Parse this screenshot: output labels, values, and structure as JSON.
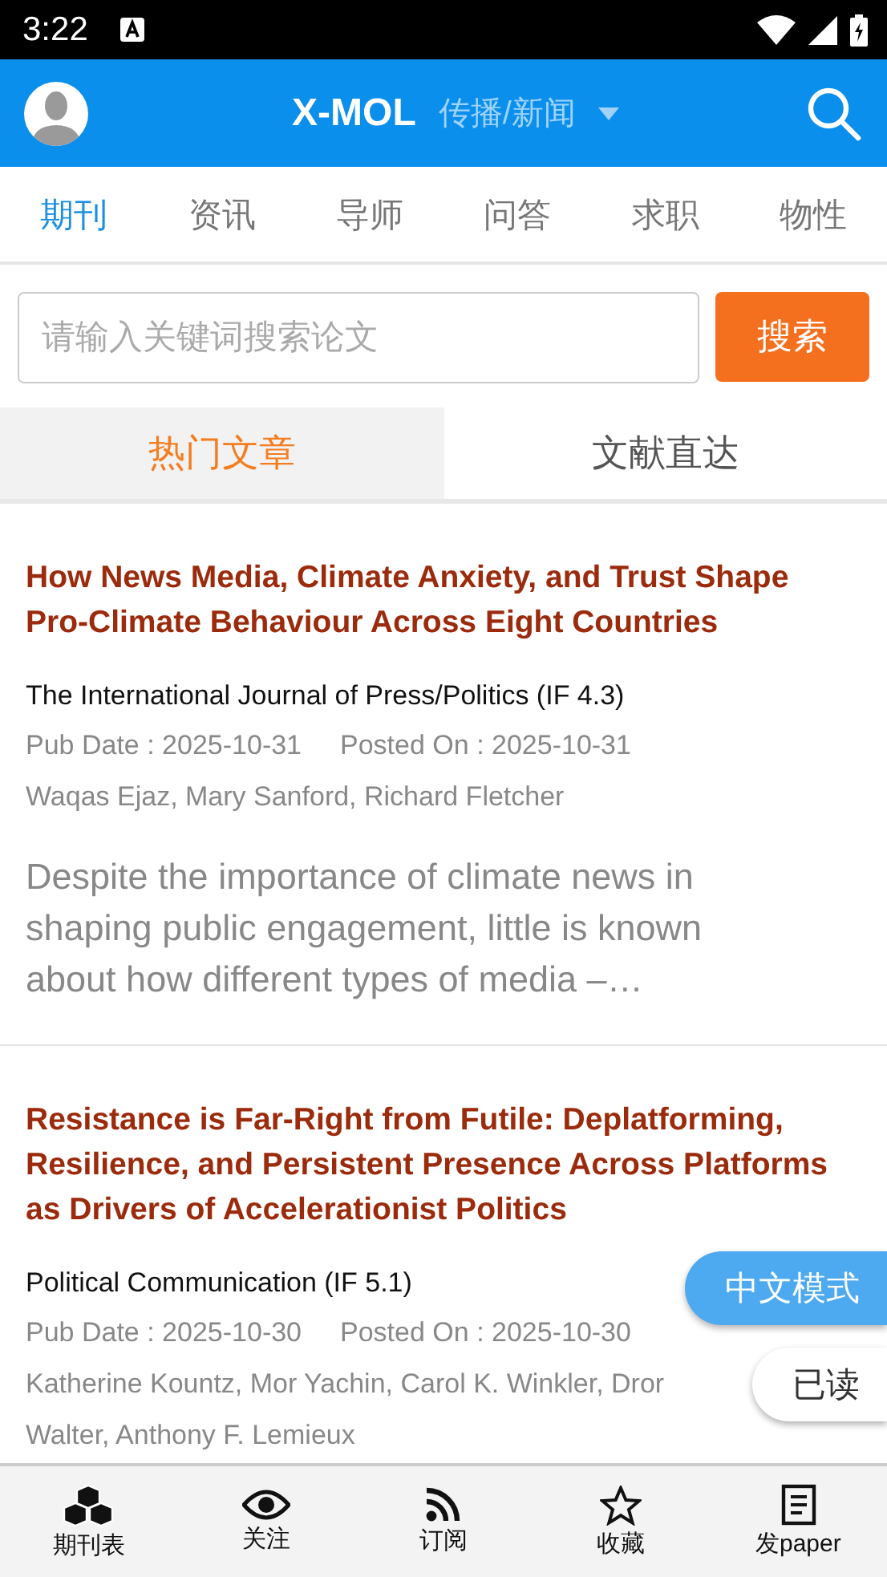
{
  "status_bar": {
    "time": "3:22"
  },
  "header": {
    "logo": "X-MOL",
    "channel": "传播/新闻"
  },
  "tabs": [
    {
      "label": "期刊",
      "selected": true
    },
    {
      "label": "资讯",
      "selected": false
    },
    {
      "label": "导师",
      "selected": false
    },
    {
      "label": "问答",
      "selected": false
    },
    {
      "label": "求职",
      "selected": false
    },
    {
      "label": "物性",
      "selected": false
    }
  ],
  "search": {
    "placeholder": "请输入关键词搜索论文",
    "button": "搜索"
  },
  "segments": [
    {
      "label": "热门文章",
      "selected": true
    },
    {
      "label": "文献直达",
      "selected": false
    }
  ],
  "articles": [
    {
      "title": "How News Media, Climate Anxiety, and Trust Shape Pro-Climate Behaviour Across Eight Countries",
      "journal": "The International Journal of Press/Politics (IF 4.3)",
      "pub_date": "Pub Date : 2025-10-31",
      "posted_on": "Posted On : 2025-10-31",
      "authors": "Waqas Ejaz, Mary Sanford, Richard Fletcher",
      "abstract": "Despite the importance of climate news in shaping public engagement, little is known about how different types of media –…"
    },
    {
      "title": "Resistance is Far-Right from Futile: Deplatforming, Resilience, and Persistent Presence Across Platforms as Drivers of Accelerationist Politics",
      "journal": "Political Communication (IF 5.1)",
      "pub_date": "Pub Date : 2025-10-30",
      "posted_on": "Posted On : 2025-10-30",
      "authors": "Katherine Kountz, Mor Yachin, Carol K. Winkler, Dror Walter, Anthony F. Lemieux"
    }
  ],
  "floating_buttons": [
    {
      "label": "中文模式",
      "kind": "primary"
    },
    {
      "label": "已读",
      "kind": "secondary"
    }
  ],
  "bottom_nav": [
    {
      "label": "期刊表"
    },
    {
      "label": "关注"
    },
    {
      "label": "订阅"
    },
    {
      "label": "收藏"
    },
    {
      "label": "发paper"
    }
  ]
}
